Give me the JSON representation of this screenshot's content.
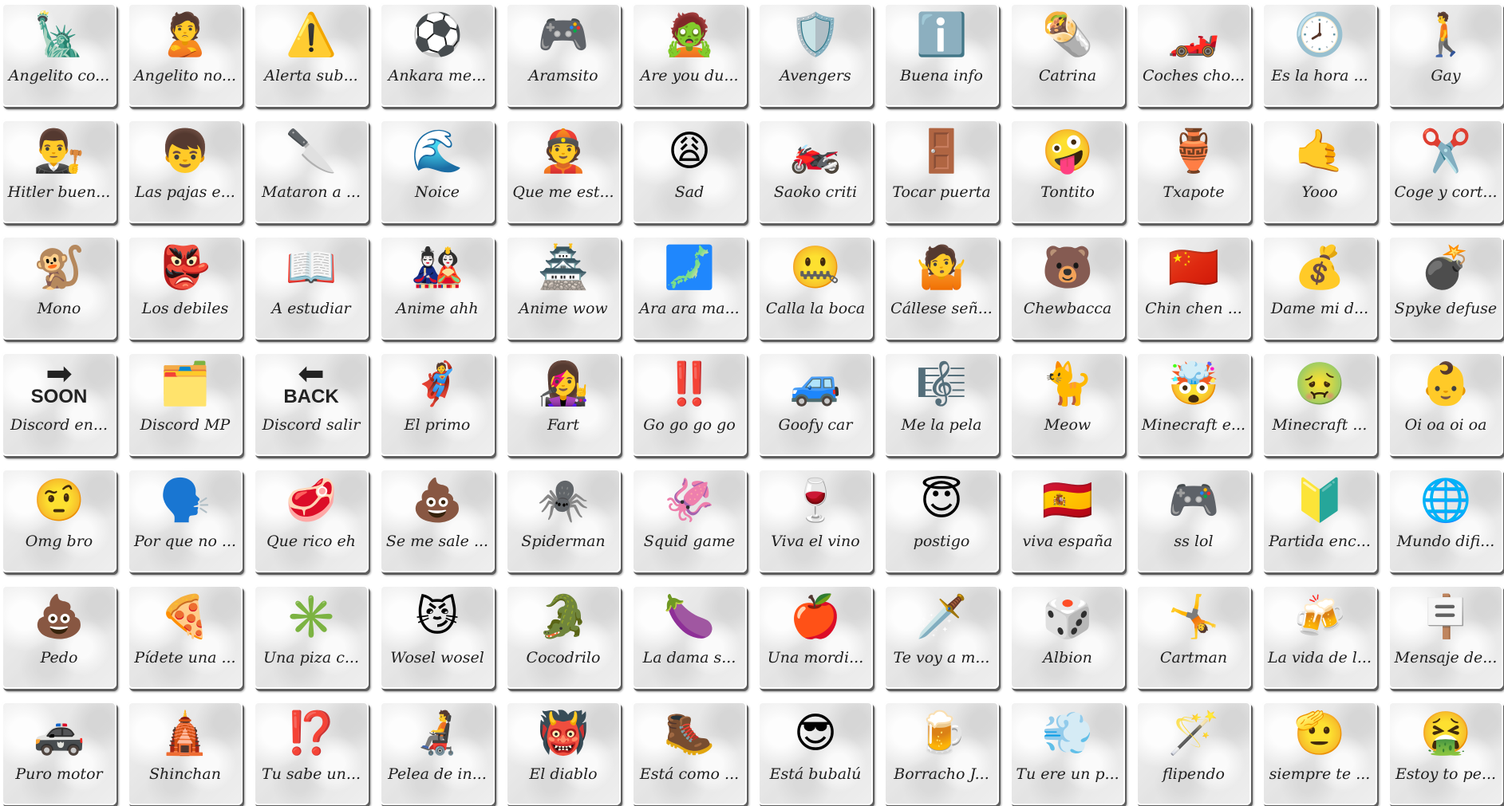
{
  "tiles": [
    {
      "label": "Angelito co...",
      "icon": "🗽",
      "icon_name": "statue-of-liberty-icon"
    },
    {
      "label": "Angelito no...",
      "icon": "🙎",
      "icon_name": "pouting-person-icon"
    },
    {
      "label": "Alerta sub...",
      "icon": "⚠️",
      "icon_name": "warning-icon"
    },
    {
      "label": "Ankara me...",
      "icon": "⚽",
      "icon_name": "soccer-ball-icon"
    },
    {
      "label": "Aramsito",
      "icon": "🎮",
      "icon_name": "game-controller-icon"
    },
    {
      "label": "Are you du...",
      "icon": "🧟",
      "icon_name": "zombie-icon"
    },
    {
      "label": "Avengers",
      "icon": "🛡️",
      "icon_name": "shield-icon"
    },
    {
      "label": "Buena info",
      "icon": "ℹ️",
      "icon_name": "info-icon"
    },
    {
      "label": "Catrina",
      "icon": "🌯",
      "icon_name": "burrito-icon"
    },
    {
      "label": "Coches cho...",
      "icon": "🏎️",
      "icon_name": "race-car-icon"
    },
    {
      "label": "Es la hora ...",
      "icon": "🕗",
      "icon_name": "clock-icon"
    },
    {
      "label": "Gay",
      "icon": "🚶",
      "icon_name": "walking-person-icon"
    },
    {
      "label": "Hitler buen...",
      "icon": "👨‍⚖️",
      "icon_name": "judge-icon"
    },
    {
      "label": "Las pajas e...",
      "icon": "👦",
      "icon_name": "boy-icon"
    },
    {
      "label": "Mataron a ...",
      "icon": "🔪",
      "icon_name": "knife-icon"
    },
    {
      "label": "Noice",
      "icon": "🌊",
      "icon_name": "wave-icon"
    },
    {
      "label": "Que me est...",
      "icon": "👲",
      "icon_name": "person-cap-icon"
    },
    {
      "label": "Sad",
      "icon": "😩",
      "icon_name": "weary-face-icon"
    },
    {
      "label": "Saoko criti",
      "icon": "🏍️",
      "icon_name": "motorcycle-icon"
    },
    {
      "label": "Tocar puerta",
      "icon": "🚪",
      "icon_name": "door-icon"
    },
    {
      "label": "Tontito",
      "icon": "🤪",
      "icon_name": "zany-face-icon"
    },
    {
      "label": "Txapote",
      "icon": "🏺",
      "icon_name": "amphora-icon"
    },
    {
      "label": "Yooo",
      "icon": "🤙",
      "icon_name": "call-me-hand-icon"
    },
    {
      "label": "Coge y cort...",
      "icon": "✂️",
      "icon_name": "scissors-icon"
    },
    {
      "label": "Mono",
      "icon": "🐒",
      "icon_name": "monkey-icon"
    },
    {
      "label": "Los debiles",
      "icon": "👺",
      "icon_name": "goblin-mask-icon"
    },
    {
      "label": "A estudiar",
      "icon": "📖",
      "icon_name": "open-book-icon"
    },
    {
      "label": "Anime ahh",
      "icon": "🎎",
      "icon_name": "japanese-dolls-icon"
    },
    {
      "label": "Anime wow",
      "icon": "🏯",
      "icon_name": "japanese-castle-icon"
    },
    {
      "label": "Ara ara ma...",
      "icon": "🗾",
      "icon_name": "japan-map-icon"
    },
    {
      "label": "Calla la boca",
      "icon": "🤐",
      "icon_name": "zipper-mouth-icon"
    },
    {
      "label": "Cállese señ...",
      "icon": "🤷",
      "icon_name": "person-gesturing-icon"
    },
    {
      "label": "Chewbacca",
      "icon": "🐻",
      "icon_name": "bear-icon"
    },
    {
      "label": "Chin chen ...",
      "icon": "🇨🇳",
      "icon_name": "china-flag-icon"
    },
    {
      "label": "Dame mi d...",
      "icon": "💰",
      "icon_name": "money-bag-icon"
    },
    {
      "label": "Spyke defuse",
      "icon": "💣",
      "icon_name": "bomb-icon"
    },
    {
      "label": "Discord en...",
      "icon": "➡",
      "icon_name": "soon-arrow-icon",
      "badge": "SOON"
    },
    {
      "label": "Discord MP",
      "icon": "🗂️",
      "icon_name": "card-index-icon"
    },
    {
      "label": "Discord salir",
      "icon": "⬅",
      "icon_name": "back-arrow-icon",
      "badge": "BACK"
    },
    {
      "label": "El primo",
      "icon": "🦸",
      "icon_name": "superhero-icon"
    },
    {
      "label": "Fart",
      "icon": "👩‍🎤",
      "icon_name": "singer-icon"
    },
    {
      "label": "Go go go go",
      "icon": "‼️",
      "icon_name": "double-exclamation-icon"
    },
    {
      "label": "Goofy car",
      "icon": "🚙",
      "icon_name": "suv-icon"
    },
    {
      "label": "Me la pela",
      "icon": "🎼",
      "icon_name": "musical-score-icon"
    },
    {
      "label": "Meow",
      "icon": "🐈",
      "icon_name": "cat-icon"
    },
    {
      "label": "Minecraft e...",
      "icon": "🤯",
      "icon_name": "exploding-head-icon"
    },
    {
      "label": "Minecraft ...",
      "icon": "🤢",
      "icon_name": "nauseated-face-icon"
    },
    {
      "label": "Oi oa oi oa",
      "icon": "👶",
      "icon_name": "baby-icon"
    },
    {
      "label": "Omg bro",
      "icon": "🤨",
      "icon_name": "raised-eyebrow-icon"
    },
    {
      "label": "Por que no ...",
      "icon": "🗣️",
      "icon_name": "speaking-head-icon"
    },
    {
      "label": "Que rico eh",
      "icon": "🥩",
      "icon_name": "meat-icon"
    },
    {
      "label": "Se me sale ...",
      "icon": "💩",
      "icon_name": "poop-icon"
    },
    {
      "label": "Spiderman",
      "icon": "🕷️",
      "icon_name": "spider-icon"
    },
    {
      "label": "Squid game",
      "icon": "🦑",
      "icon_name": "squid-icon"
    },
    {
      "label": "Viva el vino",
      "icon": "🍷",
      "icon_name": "wine-glass-icon"
    },
    {
      "label": "postigo",
      "icon": "😇",
      "icon_name": "angel-face-icon"
    },
    {
      "label": "viva españa",
      "icon": "🇪🇸",
      "icon_name": "spain-flag-icon"
    },
    {
      "label": "ss lol",
      "icon": "🎮",
      "icon_name": "game-controller-icon"
    },
    {
      "label": "Partida enc...",
      "icon": "🔰",
      "icon_name": "beginner-icon"
    },
    {
      "label": "Mundo difi...",
      "icon": "🌐",
      "icon_name": "globe-icon"
    },
    {
      "label": "Pedo",
      "icon": "💩",
      "icon_name": "poop-icon"
    },
    {
      "label": "Pídete una ...",
      "icon": "🍕",
      "icon_name": "pizza-icon"
    },
    {
      "label": "Una piza c...",
      "icon": "✳️",
      "icon_name": "asterisk-icon"
    },
    {
      "label": "Wosel wosel",
      "icon": "😼",
      "icon_name": "smirk-cat-icon"
    },
    {
      "label": "Cocodrilo",
      "icon": "🐊",
      "icon_name": "crocodile-icon"
    },
    {
      "label": "La dama s...",
      "icon": "🍆",
      "icon_name": "eggplant-icon"
    },
    {
      "label": "Una mordi...",
      "icon": "🍎",
      "icon_name": "apple-icon"
    },
    {
      "label": "Te voy a m...",
      "icon": "🗡️",
      "icon_name": "dagger-icon"
    },
    {
      "label": "Albion",
      "icon": "🎲",
      "icon_name": "dice-icon"
    },
    {
      "label": "Cartman",
      "icon": "🤸",
      "icon_name": "cartwheel-icon"
    },
    {
      "label": "La vida de l...",
      "icon": "🍻",
      "icon_name": "beer-mugs-icon"
    },
    {
      "label": "Mensaje de...",
      "icon": "🪧",
      "icon_name": "signpost-icon"
    },
    {
      "label": "Puro motor",
      "icon": "🚓",
      "icon_name": "police-car-icon"
    },
    {
      "label": "Shinchan",
      "icon": "🛕",
      "icon_name": "temple-icon"
    },
    {
      "label": "Tu sabe un...",
      "icon": "⁉️",
      "icon_name": "interrobang-icon"
    },
    {
      "label": "Pelea de in...",
      "icon": "🧑‍🦼",
      "icon_name": "wheelchair-person-icon"
    },
    {
      "label": "El diablo",
      "icon": "👹",
      "icon_name": "ogre-icon"
    },
    {
      "label": "Está como ...",
      "icon": "🥾",
      "icon_name": "hiking-boot-icon"
    },
    {
      "label": "Está bubalú",
      "icon": "😎",
      "icon_name": "sunglasses-face-icon"
    },
    {
      "label": "Borracho J...",
      "icon": "🍺",
      "icon_name": "beer-mug-icon"
    },
    {
      "label": "Tu ere un p...",
      "icon": "💨",
      "icon_name": "dash-icon"
    },
    {
      "label": "flipendo",
      "icon": "🪄",
      "icon_name": "magic-wand-icon"
    },
    {
      "label": "siempre te ...",
      "icon": "🫡",
      "icon_name": "saluting-face-icon"
    },
    {
      "label": "Estoy to pe...",
      "icon": "🤮",
      "icon_name": "vomiting-face-icon"
    }
  ]
}
